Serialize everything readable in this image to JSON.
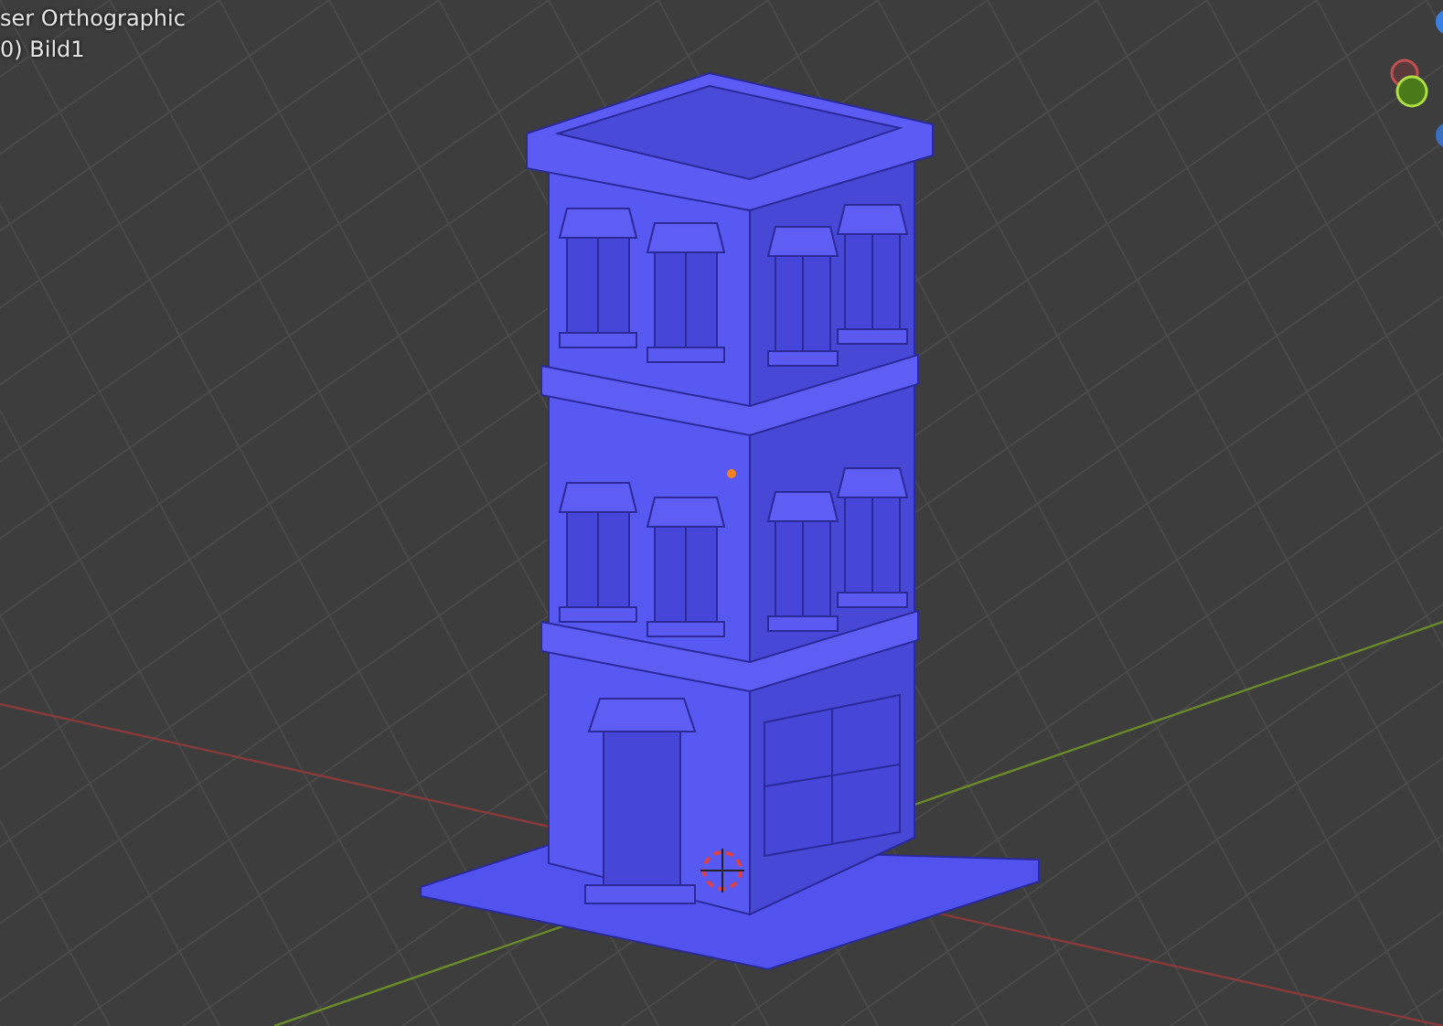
{
  "viewport": {
    "view_name": "ser Orthographic",
    "object_label": "0) Bild1"
  }
}
